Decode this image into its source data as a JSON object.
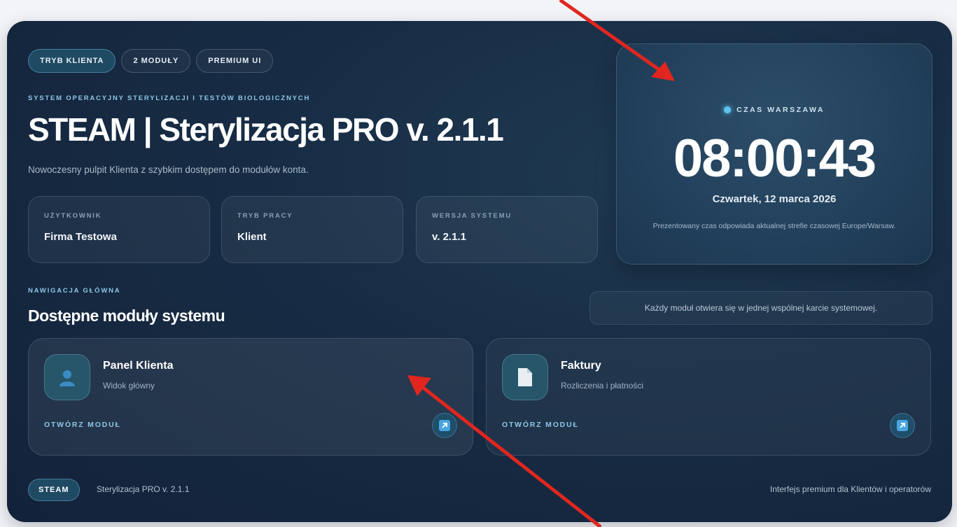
{
  "chips": [
    "TRYB KLIENTA",
    "2 MODUŁY",
    "PREMIUM UI"
  ],
  "eyebrow": "SYSTEM OPERACYJNY STERYLIZACJI I TESTÓW BIOLOGICZNYCH",
  "title": "STEAM | Sterylizacja PRO v. 2.1.1",
  "subtitle": "Nowoczesny pulpit Klienta z szybkim dostępem do modułów konta.",
  "info_cards": [
    {
      "label": "UŻYTKOWNIK",
      "value": "Firma Testowa"
    },
    {
      "label": "TRYB PRACY",
      "value": "Klient"
    },
    {
      "label": "WERSJA SYSTEMU",
      "value": "v. 2.1.1"
    }
  ],
  "clock": {
    "label": "CZAS WARSZAWA",
    "time": "08:00:43",
    "date": "Czwartek, 12 marca 2026",
    "note": "Prezentowany czas odpowiada aktualnej strefie czasowej Europe/Warsaw."
  },
  "nav": {
    "eyebrow": "NAWIGACJA GŁÓWNA",
    "title": "Dostępne moduły systemu",
    "note": "Każdy moduł otwiera się w jednej wspólnej karcie systemowej."
  },
  "modules": [
    {
      "name": "Panel Klienta",
      "desc": "Widok główny",
      "open": "OTWÓRZ MODUŁ",
      "icon": "user-icon"
    },
    {
      "name": "Faktury",
      "desc": "Rozliczenia i płatności",
      "open": "OTWÓRZ MODUŁ",
      "icon": "document-icon"
    }
  ],
  "footer": {
    "chip": "STEAM",
    "text": "Sterylizacja PRO v. 2.1.1",
    "right": "Interfejs premium dla Klientów i operatorów"
  },
  "colors": {
    "accent": "#8ec7e6",
    "annotation_arrow": "#e0261e",
    "panel": "#172c44"
  }
}
